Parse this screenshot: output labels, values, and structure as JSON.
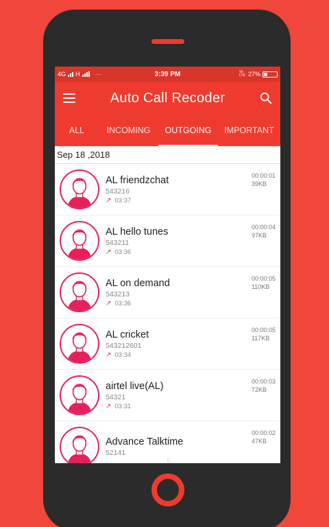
{
  "status_bar": {
    "left_network": "4G",
    "left_network2": "H",
    "more": "···",
    "time": "3:39 PM",
    "vo_lte": "Vo LTE",
    "battery": "27%",
    "battery_level": 0.27
  },
  "app": {
    "title": "Auto Call Recoder",
    "accent": "#ef3b2f",
    "avatar_color": "#e6205a"
  },
  "tabs": [
    {
      "label": "ALL",
      "active": false
    },
    {
      "label": "INCOMING",
      "active": false
    },
    {
      "label": "OUTGOING",
      "active": true
    },
    {
      "label": "IMPORTANT",
      "active": false
    }
  ],
  "date_header": "Sep 18 ,2018",
  "calls": [
    {
      "name": "AL friendzchat",
      "number": "543216",
      "time": "03:37",
      "duration": "00:00:01",
      "size": "39KB"
    },
    {
      "name": "AL hello tunes",
      "number": "543211",
      "time": "03:36",
      "duration": "00:00:04",
      "size": "97KB"
    },
    {
      "name": "AL on demand",
      "number": "543213",
      "time": "03:36",
      "duration": "00:00:05",
      "size": "110KB"
    },
    {
      "name": "AL cricket",
      "number": "543212601",
      "time": "03:34",
      "duration": "00:00:05",
      "size": "117KB"
    },
    {
      "name": "airtel live(AL)",
      "number": "54321",
      "time": "03:31",
      "duration": "00:00:03",
      "size": "72KB"
    },
    {
      "name": "Advance Talktime",
      "number": "52141",
      "time": "",
      "duration": "00:00:02",
      "size": "47KB"
    }
  ],
  "page_number": "6"
}
